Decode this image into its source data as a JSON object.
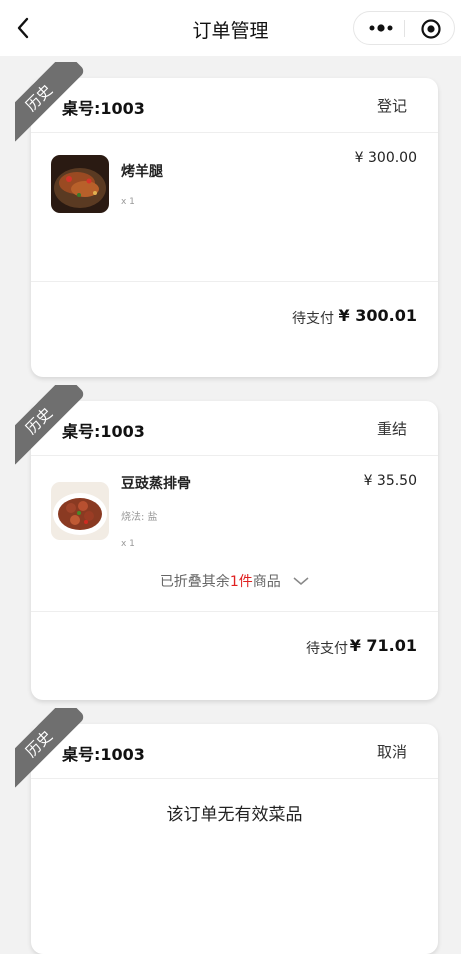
{
  "navbar": {
    "title": "订单管理"
  },
  "orders": [
    {
      "ribbon": "历史",
      "table": "桌号:1003",
      "action": "登记",
      "items": [
        {
          "name": "烤羊腿",
          "price": "¥ 300.00",
          "qty": "x 1",
          "spec": ""
        }
      ],
      "status": "待支付",
      "total": "¥ 300.01"
    },
    {
      "ribbon": "历史",
      "table": "桌号:1003",
      "action": "重结",
      "items": [
        {
          "name": "豆豉蒸排骨",
          "price": "¥ 35.50",
          "qty": "x 1",
          "spec": "烧法: 盐"
        }
      ],
      "fold": {
        "prefix": "已折叠其余",
        "count": "1件",
        "suffix": "商品"
      },
      "status": "待支付",
      "total": "¥ 71.01"
    },
    {
      "ribbon": "历史",
      "table": "桌号:1003",
      "action": "取消",
      "empty_message": "该订单无有效菜品"
    }
  ],
  "colors": {
    "ribbon": "#6f6f6f",
    "highlight": "#e02020",
    "background": "#f2f2f2"
  },
  "icons": [
    "back-icon",
    "more-icon",
    "target-icon",
    "chevron-down-icon"
  ]
}
